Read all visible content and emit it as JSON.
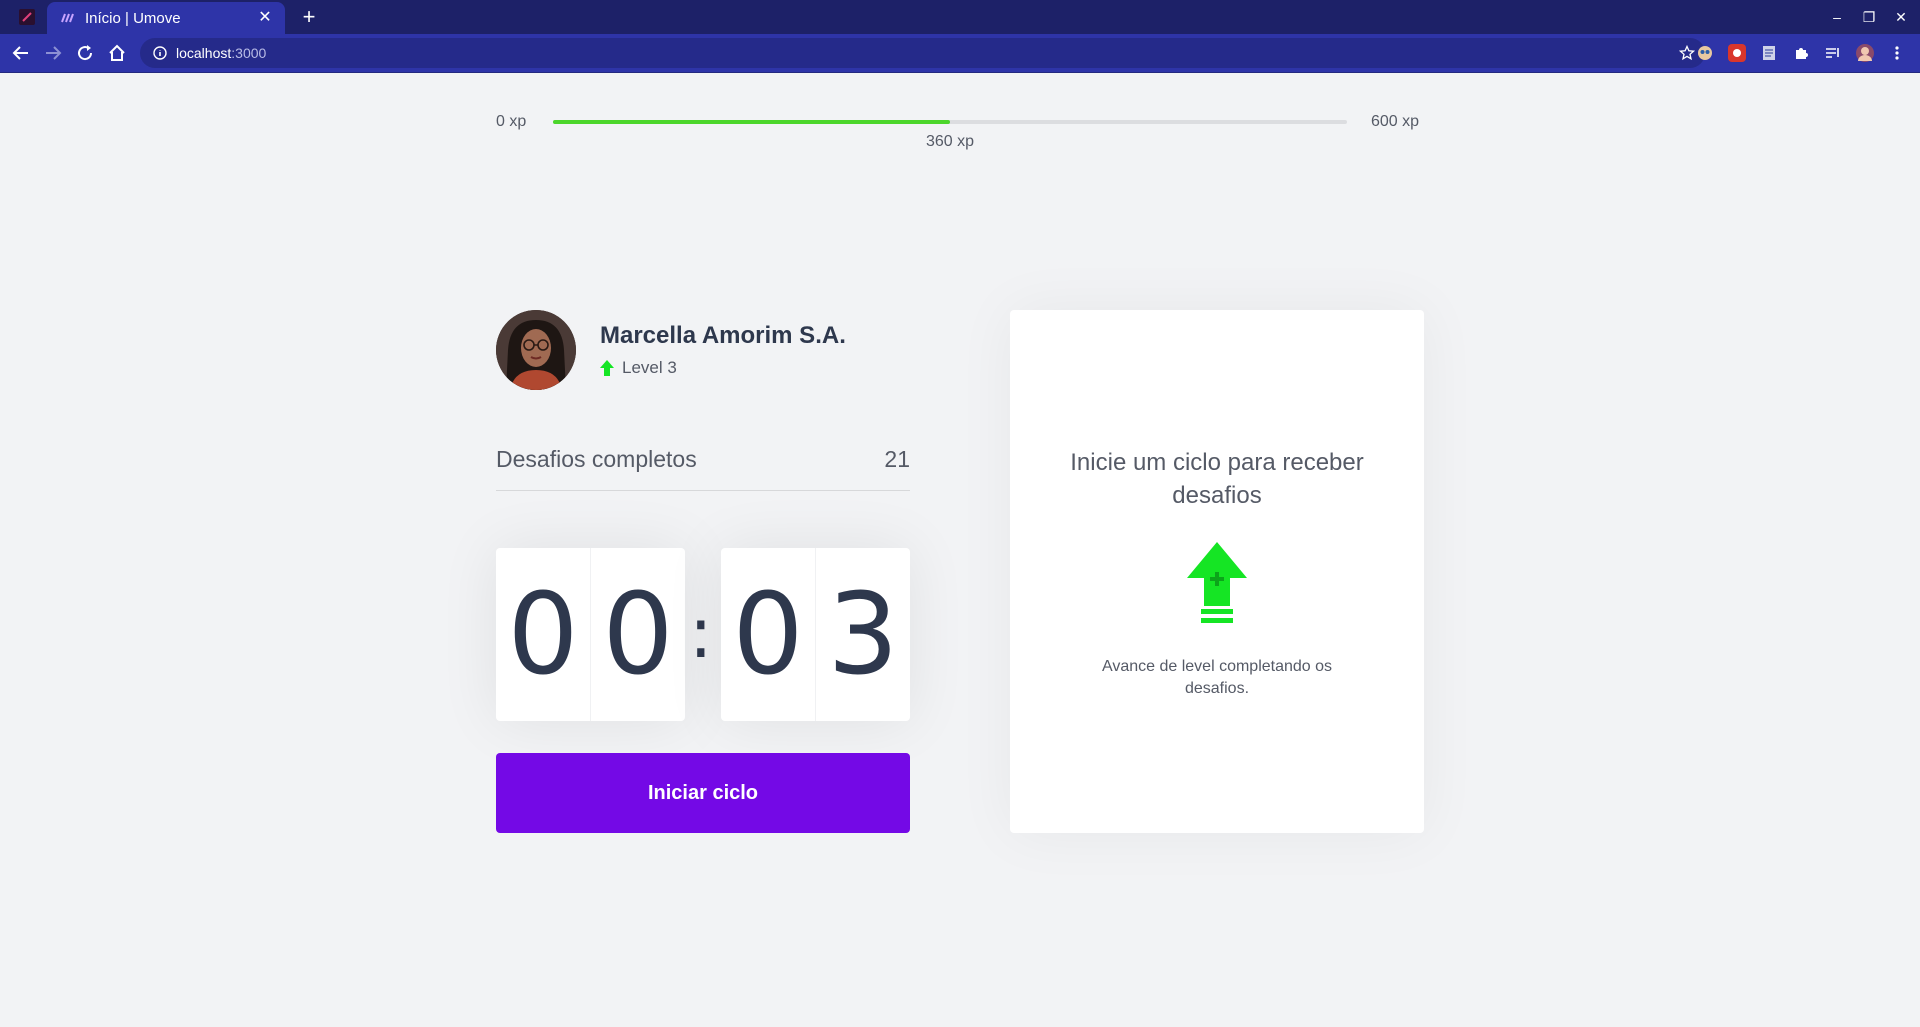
{
  "browser": {
    "tab_title": "Início | Umove",
    "url_host": "localhost",
    "url_port": ":3000"
  },
  "experience": {
    "start_label": "0 xp",
    "end_label": "600 xp",
    "current_label": "360 xp",
    "current_fraction": 0.5
  },
  "profile": {
    "name": "Marcella Amorim S.A.",
    "level_label": "Level 3"
  },
  "completed_challenges": {
    "label": "Desafios completos",
    "count": "21"
  },
  "countdown": {
    "minute_left": "0",
    "minute_right": "0",
    "separator": ":",
    "second_left": "0",
    "second_right": "3"
  },
  "start_button_label": "Iniciar ciclo",
  "challenge_box": {
    "heading": "Inicie um ciclo para receber desafios",
    "description": "Avance de level completando os desafios."
  },
  "colors": {
    "accent": "#7409e6",
    "progress": "#4cd62b",
    "level_green": "#15e524",
    "text_dark": "#2e384d",
    "text_muted": "#555a66"
  },
  "icons": {
    "level_up": "level-up-arrow-icon",
    "back": "back-arrow-icon",
    "forward": "forward-arrow-icon",
    "reload": "reload-icon",
    "home": "home-icon"
  }
}
